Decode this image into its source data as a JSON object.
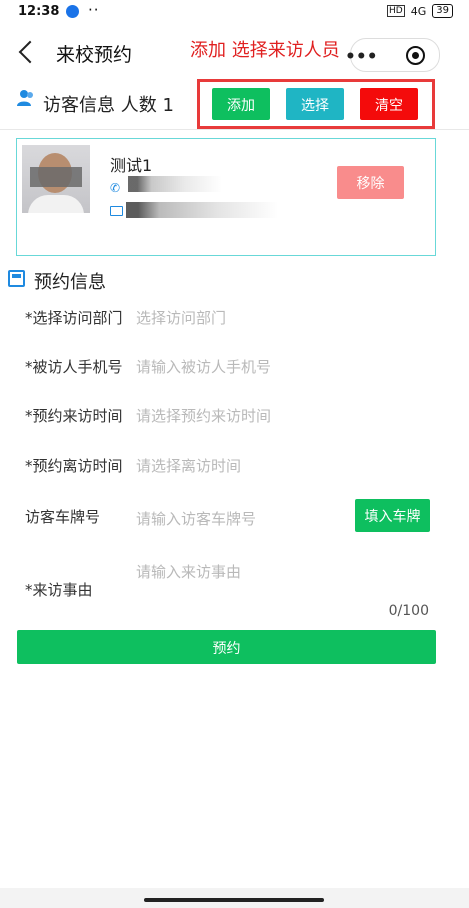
{
  "status_bar": {
    "time": "12:38",
    "dots": "··",
    "hd": "HD",
    "network": "4G",
    "battery": "39"
  },
  "header": {
    "title": "来校预约",
    "annotation": "添加 选择来访人员",
    "more": "•••"
  },
  "visitor_section": {
    "title": "访客信息 人数 1",
    "buttons": {
      "add": "添加",
      "select": "选择",
      "clear": "清空"
    },
    "visitor": {
      "name": "测试1",
      "remove": "移除"
    }
  },
  "reservation_section": {
    "title": "预约信息",
    "fields": [
      {
        "label": "*选择访问部门",
        "placeholder": "选择访问部门"
      },
      {
        "label": "*被访人手机号",
        "placeholder": "请输入被访人手机号"
      },
      {
        "label": "*预约来访时间",
        "placeholder": "请选择预约来访时间"
      },
      {
        "label": "*预约离访时间",
        "placeholder": "请选择离访时间"
      },
      {
        "label": "访客车牌号",
        "placeholder": "请输入访客车牌号"
      },
      {
        "label": "*来访事由",
        "placeholder": "请输入来访事由"
      }
    ],
    "plate_button": "填入车牌",
    "counter": "0/100",
    "submit": "预约"
  },
  "colors": {
    "green": "#0ebf5f",
    "teal": "#1fb5c4",
    "red": "#f40b0b",
    "pink": "#f98c8c",
    "blue": "#1f8ae0"
  }
}
